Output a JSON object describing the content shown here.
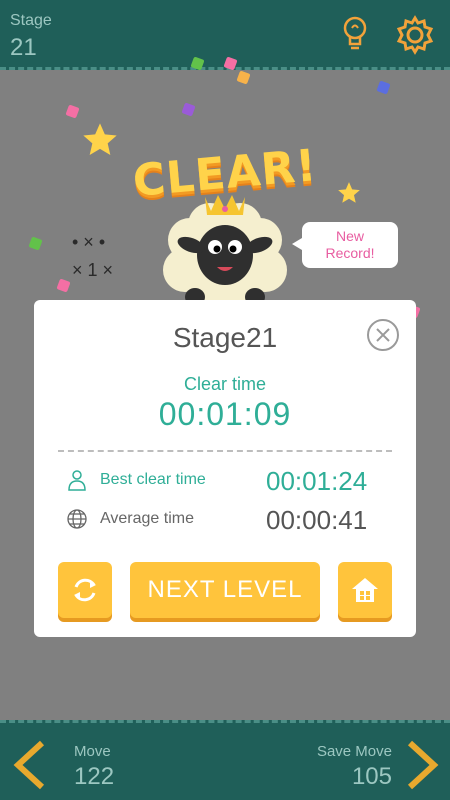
{
  "header": {
    "stage_label": "Stage",
    "stage_number": "21",
    "hint_icon": "lightbulb-icon",
    "settings_icon": "gear-icon"
  },
  "board": {
    "cells_row1": "•  ×  •",
    "cells_row2": "×  1  ×"
  },
  "banner": {
    "title": "CLEAR!",
    "new_record_line1": "New",
    "new_record_line2": "Record!"
  },
  "modal": {
    "title": "Stage21",
    "clear_time_label": "Clear time",
    "clear_time_value": "00:01:09",
    "best_label": "Best clear time",
    "best_value": "00:01:24",
    "average_label": "Average time",
    "average_value": "00:00:41",
    "next_level_label": "NEXT LEVEL"
  },
  "footer": {
    "move_label": "Move",
    "move_value": "122",
    "save_move_label": "Save Move",
    "save_move_value": "105"
  },
  "colors": {
    "bar": "#1f5f59",
    "accent_teal": "#2fae97",
    "button_yellow": "#ffc43c",
    "banner_yellow": "#ffd34a",
    "record_pink": "#e85da1"
  }
}
